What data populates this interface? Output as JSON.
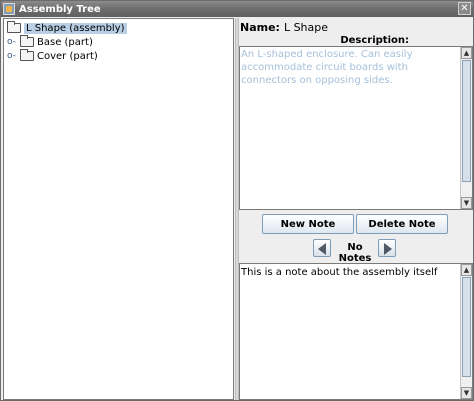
{
  "window": {
    "title": "Assembly Tree",
    "close_glyph": "✕"
  },
  "tree": {
    "root": {
      "label": "L Shape (assembly)",
      "icon": "folder-icon"
    },
    "children": [
      {
        "label": "Base (part)",
        "icon": "folder-icon",
        "handle": "o-"
      },
      {
        "label": "Cover (part)",
        "icon": "folder-icon",
        "handle": "o-"
      }
    ]
  },
  "details": {
    "name_label": "Name:",
    "name_value": "L Shape",
    "description_label": "Description:",
    "description_text": "An L-shaped enclosure. Can easily accommodate circuit boards with connectors on opposing sides."
  },
  "notes": {
    "new_button": "New Note",
    "delete_button": "Delete Note",
    "status": "No Notes",
    "note_text": "This is a note about the assembly itself"
  },
  "colors": {
    "selection": "#b8cfe5",
    "description_text": "#a6c0da",
    "button_border": "#7f9db9"
  }
}
